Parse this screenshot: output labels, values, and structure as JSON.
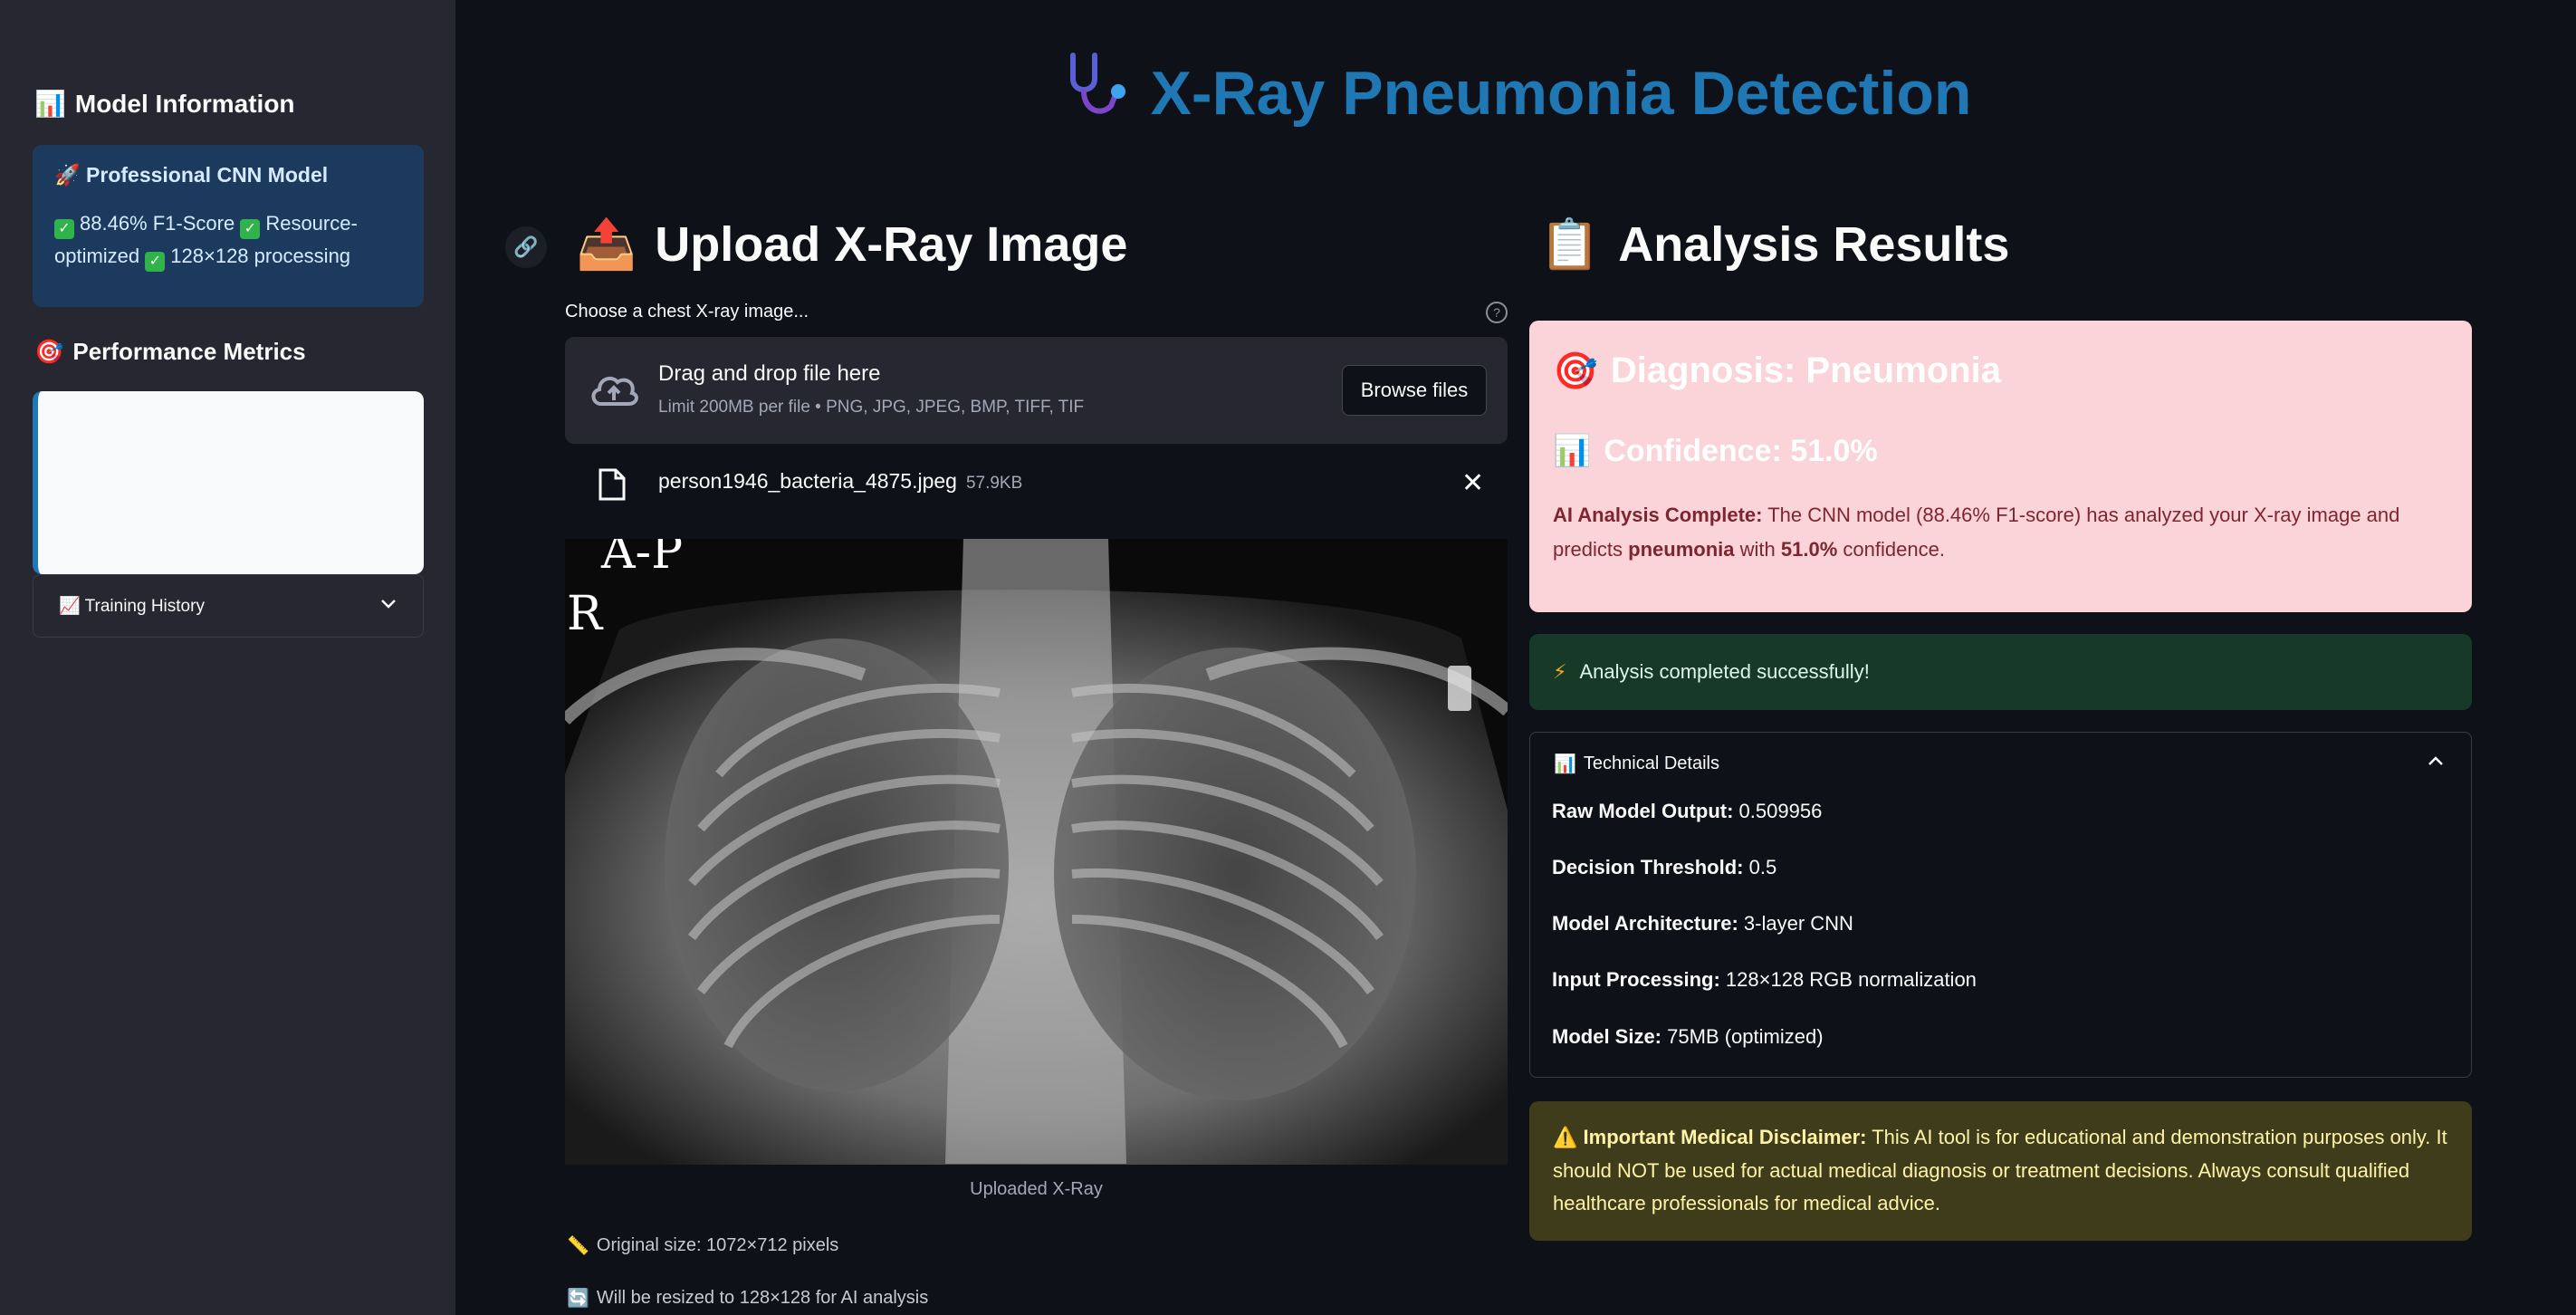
{
  "sidebar": {
    "model_info_icon": "📊",
    "model_info_title": "Model Information",
    "info_box": {
      "icon": "🚀",
      "heading": "Professional CNN Model",
      "item1": "88.46% F1-Score",
      "item2": "Resource-optimized",
      "item3": "128×128 processing"
    },
    "perf_icon": "🎯",
    "perf_title": "Performance Metrics",
    "training_icon": "📈",
    "training_label": "Training History"
  },
  "header": {
    "icon": "🩺",
    "title": "X-Ray Pneumonia Detection"
  },
  "upload": {
    "icon": "📤",
    "heading": "Upload X-Ray Image",
    "label": "Choose a chest X-ray image...",
    "drop_main": "Drag and drop file here",
    "drop_sub": "Limit 200MB per file • PNG, JPG, JPEG, BMP, TIFF, TIF",
    "browse_label": "Browse files",
    "file_name": "person1946_bacteria_4875.jpeg",
    "file_size": "57.9KB",
    "xray_text_ap": "A-P",
    "xray_text_r": "R",
    "caption": "Uploaded X-Ray",
    "original_size": "Original size: 1072×712 pixels",
    "resize_note": "Will be resized to 128×128 for AI analysis"
  },
  "results": {
    "icon": "📋",
    "heading": "Analysis Results",
    "diagnosis_icon": "🎯",
    "diagnosis": "Diagnosis: Pneumonia",
    "confidence_icon": "📊",
    "confidence": "Confidence: 51.0%",
    "analysis_lead": "AI Analysis Complete:",
    "analysis_text1": "The CNN model (88.46% F1-score) has analyzed your X-ray image and predicts",
    "analysis_bold_class": "pneumonia",
    "analysis_with": "with",
    "analysis_bold_conf": "51.0%",
    "analysis_end": "confidence.",
    "success_icon": "⚡",
    "success": "Analysis completed successfully!",
    "tech_icon": "📊",
    "tech_title": "Technical Details",
    "tech": [
      {
        "label": "Raw Model Output:",
        "value": "0.509956"
      },
      {
        "label": "Decision Threshold:",
        "value": "0.5"
      },
      {
        "label": "Model Architecture:",
        "value": "3-layer CNN"
      },
      {
        "label": "Input Processing:",
        "value": "128×128 RGB normalization"
      },
      {
        "label": "Model Size:",
        "value": "75MB (optimized)"
      }
    ],
    "disclaimer_icon": "⚠️",
    "disclaimer_lead": "Important Medical Disclaimer:",
    "disclaimer_text": "This AI tool is for educational and demonstration purposes only. It should NOT be used for actual medical diagnosis or treatment decisions. Always consult qualified healthcare professionals for medical advice."
  },
  "colors": {
    "accent": "#1f77b4",
    "error_bg": "#fad4d8",
    "success_bg": "#173928",
    "warning_bg": "#3e3c1a"
  }
}
